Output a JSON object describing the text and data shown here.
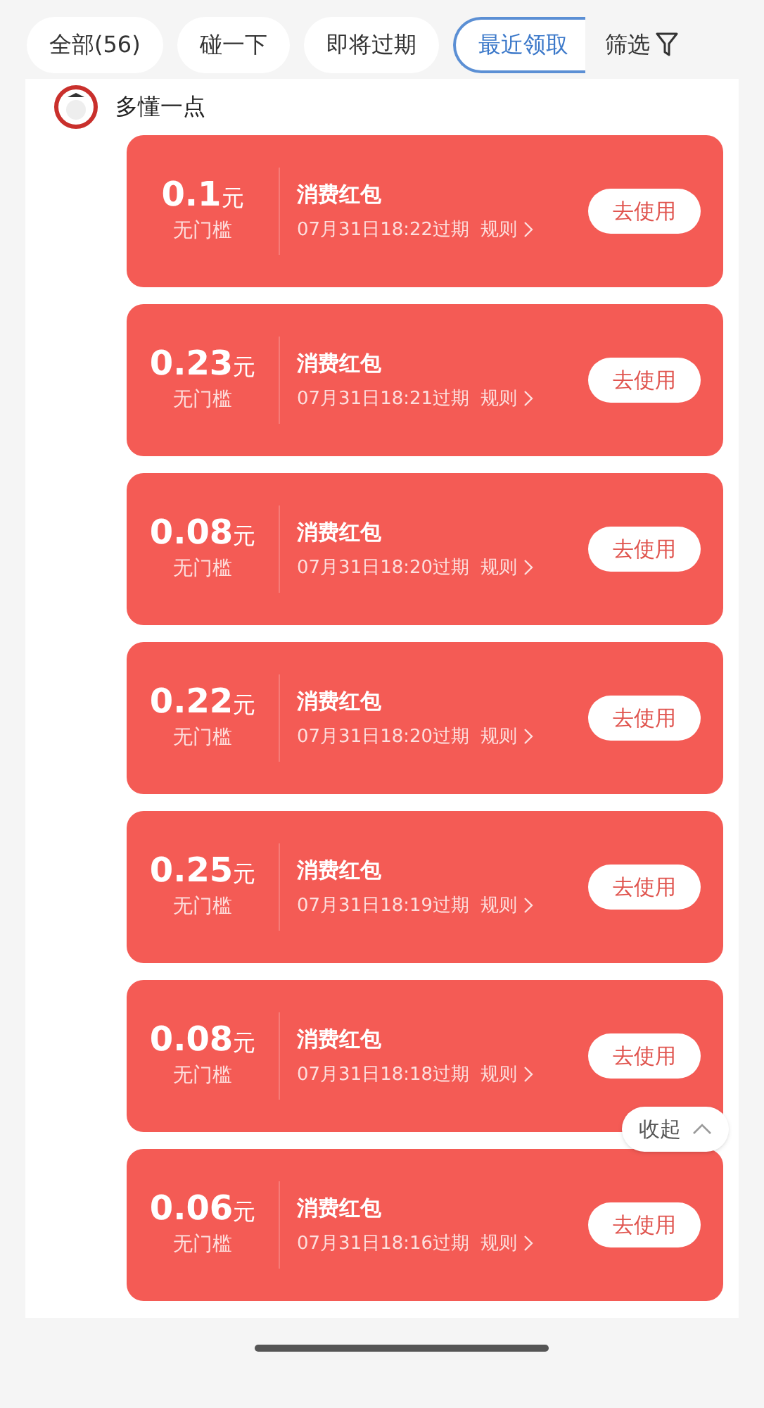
{
  "tabs": [
    {
      "label": "全部(56)",
      "selected": false
    },
    {
      "label": "碰一下",
      "selected": false
    },
    {
      "label": "即将过期",
      "selected": false
    },
    {
      "label": "最近领取",
      "selected": true
    }
  ],
  "filter": {
    "label": "筛选"
  },
  "store": {
    "name": "多懂一点"
  },
  "coupons": [
    {
      "amount": "0.1",
      "unit": "元",
      "condition": "无门槛",
      "title": "消费红包",
      "expiry": "07月31日18:22过期",
      "rule": "规则",
      "button": "去使用"
    },
    {
      "amount": "0.23",
      "unit": "元",
      "condition": "无门槛",
      "title": "消费红包",
      "expiry": "07月31日18:21过期",
      "rule": "规则",
      "button": "去使用"
    },
    {
      "amount": "0.08",
      "unit": "元",
      "condition": "无门槛",
      "title": "消费红包",
      "expiry": "07月31日18:20过期",
      "rule": "规则",
      "button": "去使用"
    },
    {
      "amount": "0.22",
      "unit": "元",
      "condition": "无门槛",
      "title": "消费红包",
      "expiry": "07月31日18:20过期",
      "rule": "规则",
      "button": "去使用"
    },
    {
      "amount": "0.25",
      "unit": "元",
      "condition": "无门槛",
      "title": "消费红包",
      "expiry": "07月31日18:19过期",
      "rule": "规则",
      "button": "去使用"
    },
    {
      "amount": "0.08",
      "unit": "元",
      "condition": "无门槛",
      "title": "消费红包",
      "expiry": "07月31日18:18过期",
      "rule": "规则",
      "button": "去使用"
    },
    {
      "amount": "0.06",
      "unit": "元",
      "condition": "无门槛",
      "title": "消费红包",
      "expiry": "07月31日18:16过期",
      "rule": "规则",
      "button": "去使用"
    }
  ],
  "collapse": {
    "label": "收起"
  }
}
